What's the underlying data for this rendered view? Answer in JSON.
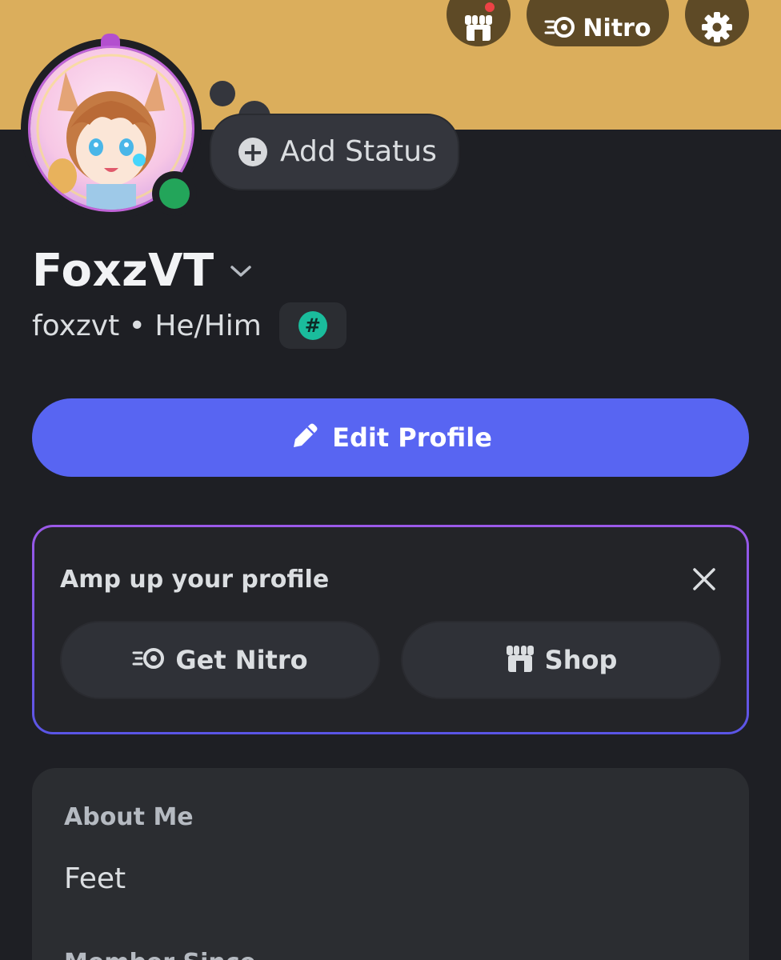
{
  "header": {
    "nitro_label": "Nitro"
  },
  "status": {
    "add_status_label": "Add Status",
    "presence": "online"
  },
  "profile": {
    "display_name": "FoxzVT",
    "handle": "foxzvt • He/Him"
  },
  "actions": {
    "edit_profile_label": "Edit Profile"
  },
  "amp_card": {
    "title": "Amp up your profile",
    "get_nitro_label": "Get Nitro",
    "shop_label": "Shop"
  },
  "about": {
    "title": "About Me",
    "text": "Feet",
    "member_since_label": "Member Since"
  },
  "colors": {
    "banner": "#dbae5c",
    "accent": "#5865f2",
    "online": "#23a55a",
    "background": "#1e1f24"
  },
  "icons": {
    "shop": "shop-icon",
    "nitro": "nitro-icon",
    "settings": "gear-icon",
    "add": "plus-circle-icon",
    "edit": "pencil-icon",
    "close": "close-icon",
    "badge": "hash-badge-icon"
  }
}
